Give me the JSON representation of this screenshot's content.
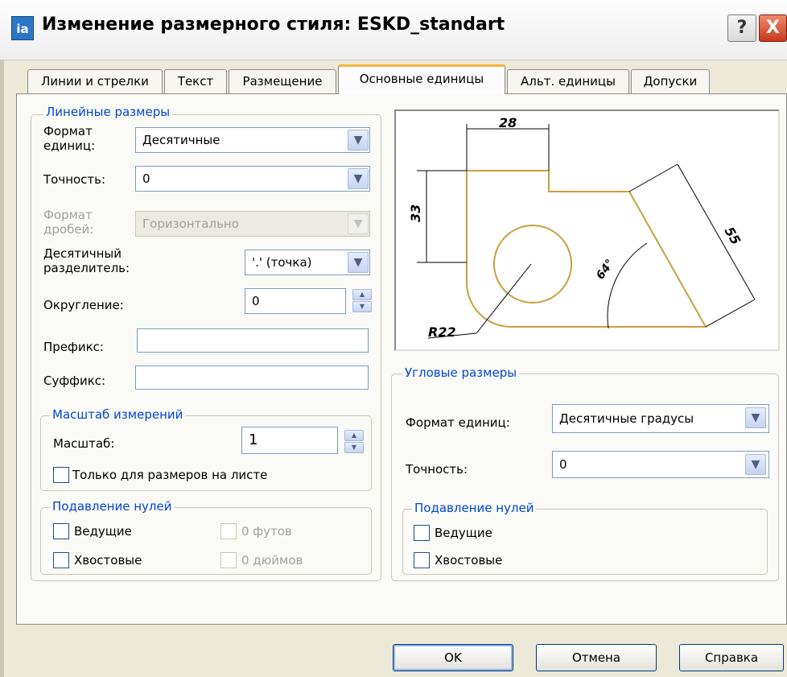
{
  "window": {
    "icon_text": "ia",
    "title": "Изменение размерного стиля: ESKD_standart",
    "help_label": "?",
    "close_label": "X"
  },
  "tabs": [
    {
      "label": "Линии и стрелки",
      "active": false
    },
    {
      "label": "Текст",
      "active": false
    },
    {
      "label": "Размещение",
      "active": false
    },
    {
      "label": "Основные единицы",
      "active": true
    },
    {
      "label": "Альт. единицы",
      "active": false
    },
    {
      "label": "Допуски",
      "active": false
    }
  ],
  "linear": {
    "legend": "Линейные размеры",
    "unit_format": {
      "label_line1": "Формат",
      "label_line2": "единиц:",
      "value": "Десятичные"
    },
    "precision": {
      "label": "Точность:",
      "value": "0"
    },
    "fraction_format": {
      "label_line1": "Формат",
      "label_line2": "дробей:",
      "value": "Горизонтально",
      "disabled": true
    },
    "decimal_separator": {
      "label_line1": "Десятичный",
      "label_line2": "разделитель:",
      "value": "'.' (точка)"
    },
    "round_off": {
      "label": "Округление:",
      "value": "0"
    },
    "prefix": {
      "label": "Префикс:",
      "value": ""
    },
    "suffix": {
      "label": "Суффикс:",
      "value": ""
    }
  },
  "measurement_scale": {
    "legend": "Масштаб измерений",
    "scale": {
      "label": "Масштаб:",
      "value": "1"
    },
    "layout_only": {
      "label": "Только для размеров на листе",
      "checked": false
    }
  },
  "linear_zero_suppression": {
    "legend": "Подавление нулей",
    "leading": {
      "label": "Ведущие",
      "checked": false
    },
    "trailing": {
      "label": "Хвостовые",
      "checked": false
    },
    "feet": {
      "label": "0 футов",
      "checked": false,
      "disabled": true
    },
    "inches": {
      "label": "0 дюймов",
      "checked": false,
      "disabled": true
    }
  },
  "preview": {
    "dim_top": "28",
    "dim_left": "33",
    "dim_right": "55",
    "dim_angle": "64°",
    "dim_radius": "R22",
    "outline_color": "#c8a040",
    "dimension_color": "#000000"
  },
  "angular": {
    "legend": "Угловые размеры",
    "unit_format": {
      "label": "Формат единиц:",
      "value": "Десятичные градусы"
    },
    "precision": {
      "label": "Точность:",
      "value": "0"
    }
  },
  "angular_zero_suppression": {
    "legend": "Подавление нулей",
    "leading": {
      "label": "Ведущие",
      "checked": false
    },
    "trailing": {
      "label": "Хвостовые",
      "checked": false
    }
  },
  "buttons": {
    "ok": "OK",
    "cancel": "Отмена",
    "help": "Справка"
  },
  "colors": {
    "legend_text": "#0046d5",
    "active_tab_accent": "#f3b33b",
    "dialog_background": "#ece9d8"
  }
}
